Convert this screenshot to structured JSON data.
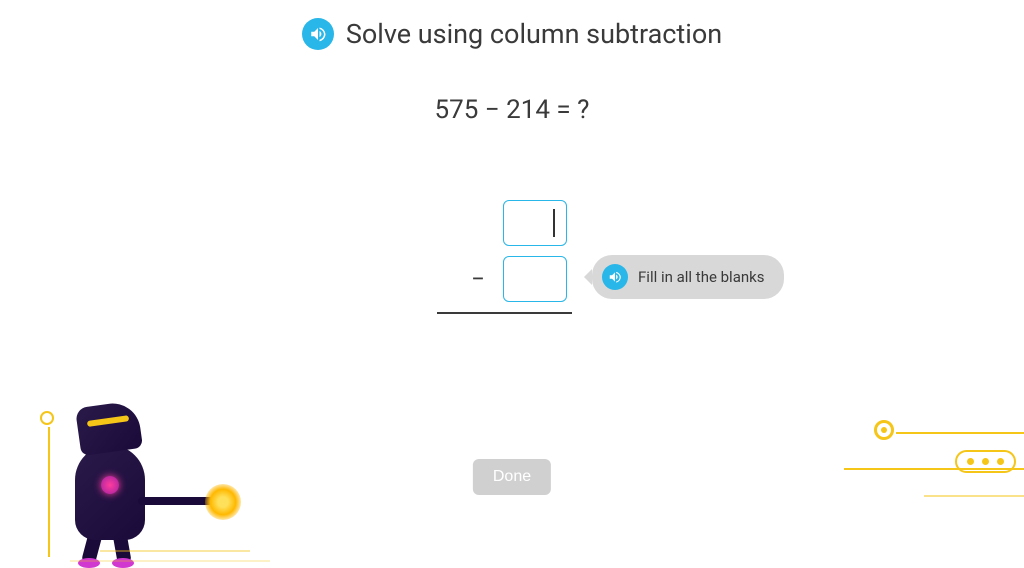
{
  "title": "Solve using column subtraction",
  "equation": "575 − 214 = ?",
  "operator": "−",
  "inputs": {
    "top": "",
    "bottom": ""
  },
  "hint": "Fill in all the blanks",
  "done_label": "Done"
}
